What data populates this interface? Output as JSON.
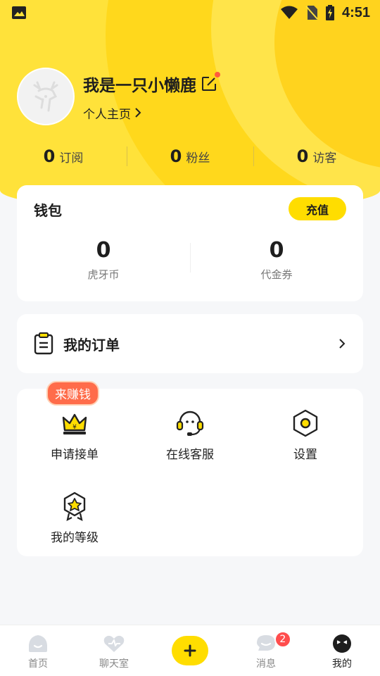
{
  "status_bar": {
    "time": "4:51"
  },
  "profile": {
    "username": "我是一只小懒鹿",
    "homepage_link": "个人主页"
  },
  "stats": [
    {
      "count": "0",
      "label": "订阅"
    },
    {
      "count": "0",
      "label": "粉丝"
    },
    {
      "count": "0",
      "label": "访客"
    }
  ],
  "wallet": {
    "title": "钱包",
    "recharge_label": "充值",
    "huya_coin": {
      "value": "0",
      "label": "虎牙币"
    },
    "voucher": {
      "value": "0",
      "label": "代金券"
    }
  },
  "orders": {
    "label": "我的订单"
  },
  "grid": {
    "earn_badge": "来赚钱",
    "items": [
      {
        "label": "申请接单",
        "icon": "crown-yen-icon"
      },
      {
        "label": "在线客服",
        "icon": "headset-icon"
      },
      {
        "label": "设置",
        "icon": "settings-hexagon-icon"
      },
      {
        "label": "我的等级",
        "icon": "level-star-badge-icon"
      }
    ]
  },
  "tabbar": {
    "items": [
      {
        "label": "首页",
        "icon": "home-icon"
      },
      {
        "label": "聊天室",
        "icon": "chatroom-icon"
      },
      {
        "label": "",
        "icon": "plus-icon"
      },
      {
        "label": "消息",
        "icon": "message-icon",
        "badge": "2"
      },
      {
        "label": "我的",
        "icon": "me-icon",
        "active": true
      }
    ]
  },
  "colors": {
    "accent_yellow": "#ffdd00",
    "badge_red": "#ff4d4d",
    "earn_orange": "#ff6c4a"
  }
}
